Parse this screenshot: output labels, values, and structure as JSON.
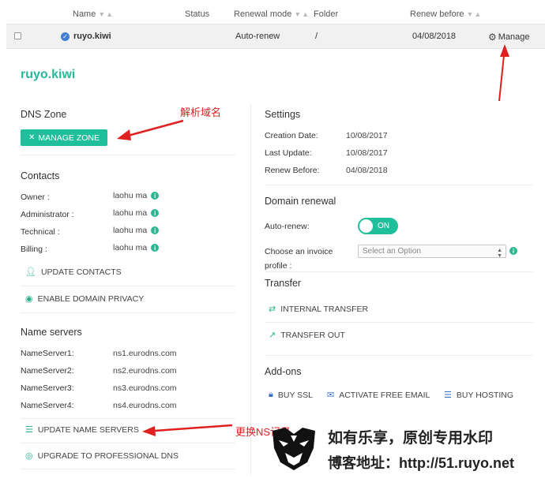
{
  "table": {
    "headers": {
      "name": "Name",
      "status": "Status",
      "renewal_mode": "Renewal mode",
      "folder": "Folder",
      "renew_before": "Renew before"
    },
    "row": {
      "domain": "ruyo.kiwi",
      "renewal_mode": "Auto-renew",
      "folder": "/",
      "renew_before": "04/08/2018",
      "manage_label": "Manage"
    }
  },
  "detail": {
    "title": "ruyo.kiwi",
    "dns_zone": {
      "title": "DNS Zone",
      "manage_zone_label": "MANAGE ZONE"
    },
    "contacts": {
      "title": "Contacts",
      "items": [
        {
          "label": "Owner :",
          "value": "laohu ma"
        },
        {
          "label": "Administrator :",
          "value": "laohu ma"
        },
        {
          "label": "Technical :",
          "value": "laohu ma"
        },
        {
          "label": "Billing :",
          "value": "laohu ma"
        }
      ],
      "update_contacts_label": "UPDATE CONTACTS",
      "enable_privacy_label": "ENABLE DOMAIN PRIVACY"
    },
    "name_servers": {
      "title": "Name servers",
      "items": [
        {
          "label": "NameServer1:",
          "value": "ns1.eurodns.com"
        },
        {
          "label": "NameServer2:",
          "value": "ns2.eurodns.com"
        },
        {
          "label": "NameServer3:",
          "value": "ns3.eurodns.com"
        },
        {
          "label": "NameServer4:",
          "value": "ns4.eurodns.com"
        }
      ],
      "update_label": "UPDATE NAME SERVERS",
      "upgrade_label": "UPGRADE TO PROFESSIONAL DNS"
    },
    "settings": {
      "title": "Settings",
      "items": [
        {
          "label": "Creation Date:",
          "value": "10/08/2017"
        },
        {
          "label": "Last Update:",
          "value": "10/08/2017"
        },
        {
          "label": "Renew Before:",
          "value": "04/08/2018"
        }
      ]
    },
    "domain_renewal": {
      "title": "Domain renewal",
      "auto_renew_label": "Auto-renew:",
      "toggle_label": "ON",
      "invoice_label_line1": "Choose an invoice",
      "invoice_label_line2": "profile :",
      "select_placeholder": "Select an Option"
    },
    "transfer": {
      "title": "Transfer",
      "internal_label": "INTERNAL TRANSFER",
      "out_label": "TRANSFER OUT"
    },
    "addons": {
      "title": "Add-ons",
      "buy_ssl_label": "BUY SSL",
      "free_email_label": "ACTIVATE FREE EMAIL",
      "buy_hosting_label": "BUY HOSTING"
    }
  },
  "annotations": {
    "dns": "解析域名",
    "ns": "更换NS记录"
  },
  "watermark": {
    "line1": "如有乐享，原创专用水印",
    "line2": "博客地址：http://51.ruyo.net"
  },
  "colors": {
    "accent": "#1fbf9b",
    "title_teal": "#27b89a",
    "annotation_red": "#e02020",
    "verified_blue": "#3f7fd4"
  }
}
